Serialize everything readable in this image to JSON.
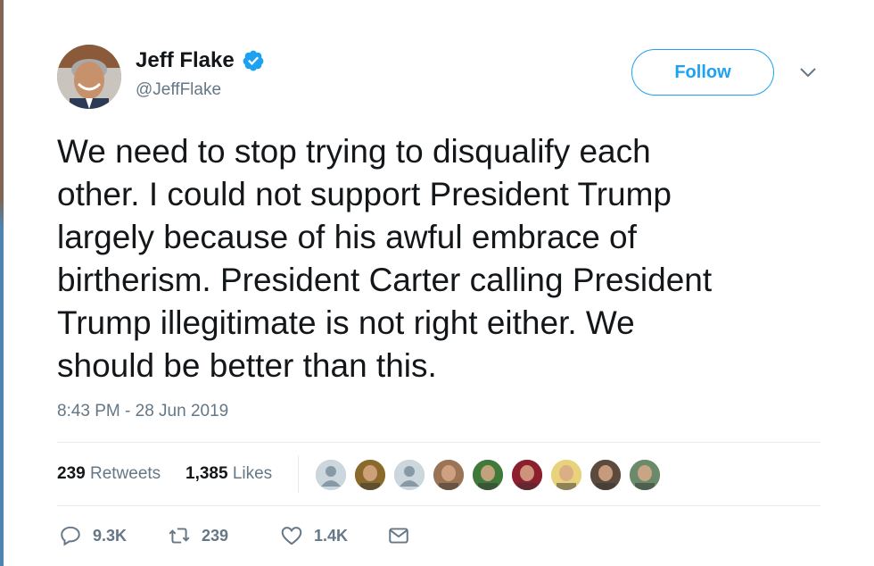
{
  "tweet": {
    "display_name": "Jeff Flake",
    "handle": "@JeffFlake",
    "follow_label": "Follow",
    "text": "We need to stop trying to disqualify each\nother. I could not support President Trump\nlargely because of his awful embrace of\nbirtherism. President Carter calling President\nTrump illegitimate is not right either. We\nshould be better than this.",
    "timestamp": "8:43 PM - 28 Jun 2019"
  },
  "stats": {
    "retweets_count": "239",
    "retweets_label": "Retweets",
    "likes_count": "1,385",
    "likes_label": "Likes"
  },
  "actions": {
    "reply_count": "9.3K",
    "retweet_count": "239",
    "like_count": "1.4K"
  },
  "colors": {
    "accent": "#1da1f2",
    "secondary_text": "#657786",
    "primary_text": "#14171a",
    "divider": "#e6ecf0"
  },
  "icons": {
    "verified": "verified-badge-icon",
    "caret": "chevron-down-icon",
    "reply": "reply-icon",
    "retweet": "retweet-icon",
    "like": "heart-icon",
    "dm": "envelope-icon"
  },
  "likers": [
    {
      "kind": "default-avatar",
      "color": "#aab8c2"
    },
    {
      "kind": "photo",
      "color": "#8a6a2a"
    },
    {
      "kind": "default-avatar",
      "color": "#aab8c2"
    },
    {
      "kind": "photo",
      "color": "#9b7456"
    },
    {
      "kind": "photo",
      "color": "#3f7a3a"
    },
    {
      "kind": "photo",
      "color": "#8c1f2e"
    },
    {
      "kind": "photo",
      "color": "#e9d27c"
    },
    {
      "kind": "photo",
      "color": "#5c4a3d"
    },
    {
      "kind": "photo",
      "color": "#6a8a6a"
    }
  ]
}
